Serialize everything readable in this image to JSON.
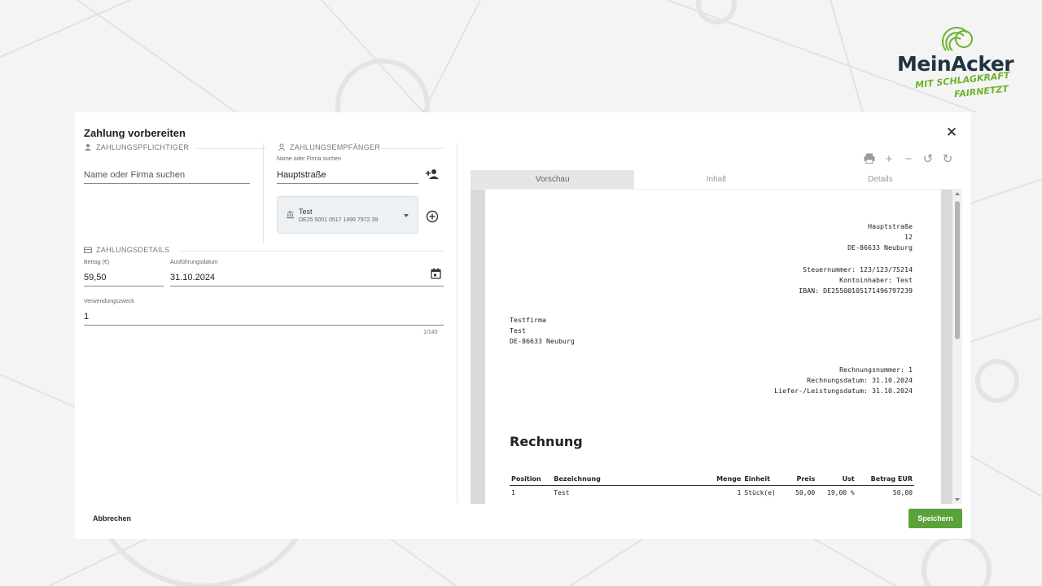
{
  "brand": {
    "name": "MeinAcker",
    "tagline_1": "MIT SCHLAGKRAFT",
    "tagline_2": "FAIRNETZT",
    "color_primary": "#1f3340",
    "color_accent": "#6cb32a"
  },
  "dialog": {
    "title": "Zahlung vorbereiten",
    "close_icon": "close-icon",
    "payer": {
      "section_label": "ZAHLUNGSPFLICHTIGER",
      "search_placeholder": "Name oder Firma suchen"
    },
    "payee": {
      "section_label": "ZAHLUNGSEMPFÄNGER",
      "search_label": "Name oder Firma suchen",
      "search_value": "Hauptstraße",
      "add_contact_icon": "person-add-icon",
      "bank_account": {
        "name": "Test",
        "iban": "DE25 5001 0517 1496 7972 39"
      },
      "add_account_icon": "add-circle-icon"
    },
    "details": {
      "section_label": "ZAHLUNGSDETAILS",
      "amount_label": "Betrag (€)",
      "amount_value": "59,50",
      "date_label": "Ausführungsdatum",
      "date_value": "31.10.2024",
      "purpose_label": "Verwendungszweck",
      "purpose_value": "1",
      "purpose_counter": "1/140"
    },
    "cancel_label": "Abbrechen",
    "save_label": "Speichern",
    "save_color": "#5ca23a"
  },
  "preview": {
    "toolbar_icons": [
      "print-icon",
      "zoom-in-icon",
      "zoom-out-icon",
      "rotate-left-icon",
      "rotate-right-icon"
    ],
    "tabs": [
      "Vorschau",
      "Inhalt",
      "Details"
    ],
    "active_tab": "Vorschau",
    "invoice": {
      "sender_street": "Hauptstraße",
      "sender_number": "12",
      "sender_city": "DE-86633 Neuburg",
      "tax_number": "Steuernummer: 123/123/75214",
      "account_holder": "Kontoinhaber: Test",
      "iban": "IBAN: DE25500105171496797239",
      "recipient_company": "Testfirma",
      "recipient_name": "Test",
      "recipient_city": "DE-86633 Neuburg",
      "invoice_number": "Rechnungsnummer: 1",
      "invoice_date": "Rechnungsdatum: 31.10.2024",
      "delivery_date": "Liefer-/Leistungsdatum: 31.10.2024",
      "title": "Rechnung",
      "columns": [
        "Position",
        "Bezeichnung",
        "Menge",
        "Einheit",
        "Preis",
        "Ust",
        "Betrag EUR"
      ],
      "rows": [
        [
          "1",
          "Test",
          "1",
          "Stück(e)",
          "50,00",
          "19,00 %",
          "50,00"
        ]
      ]
    }
  }
}
